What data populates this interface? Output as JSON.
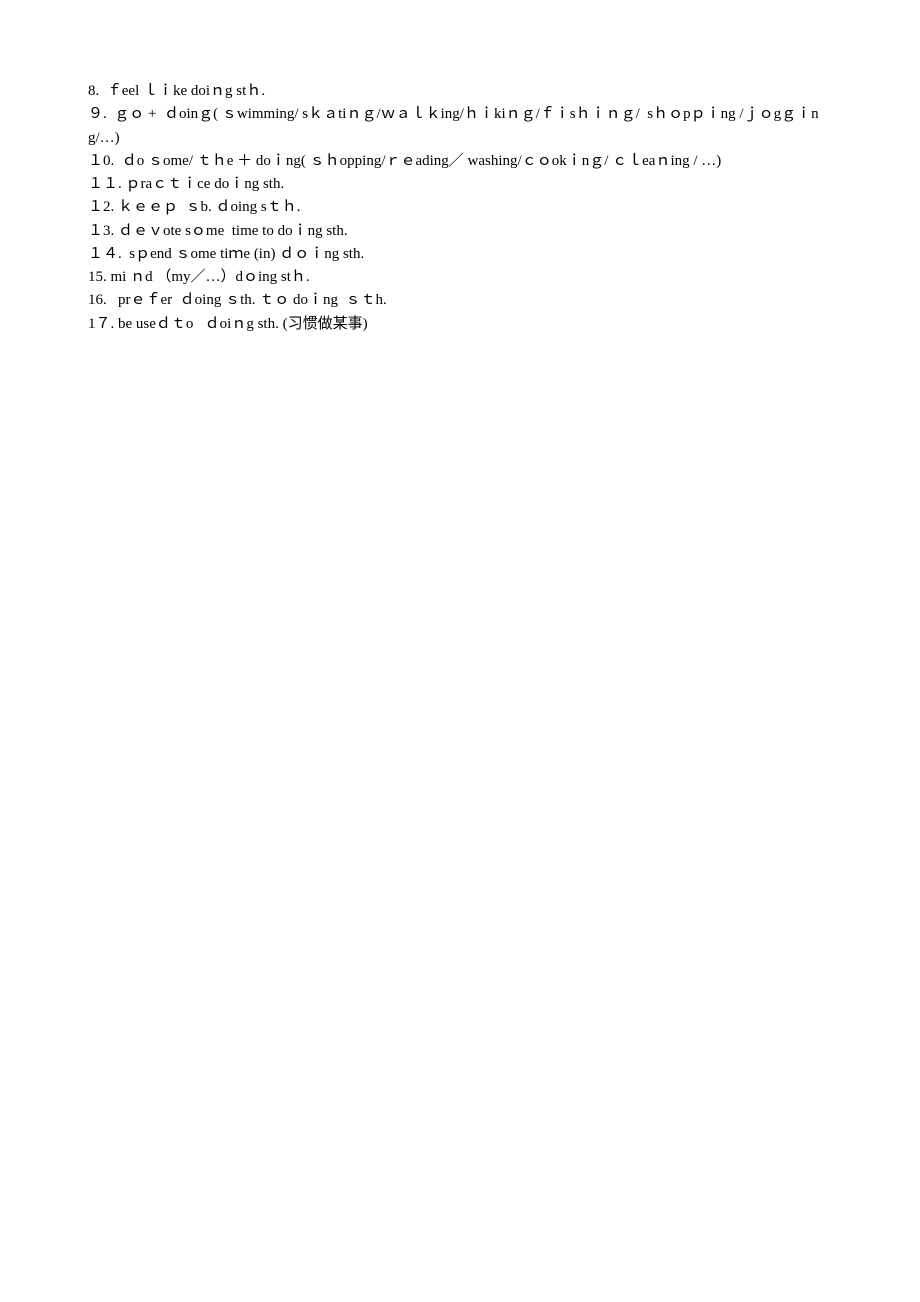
{
  "lines": [
    "8.  ｆeel ｌｉke doiｎg stｈ.",
    "９.  ｇｏ +  ｄoinｇ( ｓwimming/ sｋａtiｎｇ/ｗａｌｋing/ｈｉkiｎｇ/ｆｉsｈｉｎｇ/  sｈｏpｐｉng /ｊｏgｇｉng/…)",
    "１0.  ｄo ｓome/ ｔｈe ＋ doｉng( ｓｈopping/ｒｅading／ washing/ｃｏokｉnｇ/ ｃｌeaｎing / …)",
    "１１. ｐraｃｔｉce doｉng sth.",
    "１2. ｋｅｅｐ  ｓb. ｄoing sｔｈ.",
    "１3. ｄｅｖote sｏme  time to doｉng sth.",
    "１４.  sｐend ｓome tiｍe (in) ｄｏｉng sth.",
    "15. mi ｎd （my／…）dｏing stｈ.",
    "16.   prｅｆer  ｄoing ｓth. ｔｏ doｉng  ｓｔh.",
    "1７. be useｄｔo   ｄoiｎg sth. (习惯做某事)"
  ]
}
